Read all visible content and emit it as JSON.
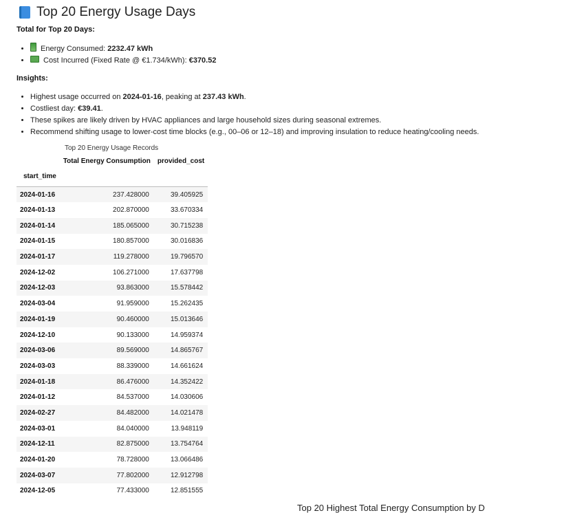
{
  "page": {
    "title": "Top 20 Energy Usage Days",
    "totals_heading": "Total for Top 20 Days:",
    "totals": [
      {
        "icon": "battery-icon",
        "label": "Energy Consumed: ",
        "value": "2232.47 kWh"
      },
      {
        "icon": "money-icon",
        "label": "Cost Incurred (Fixed Rate @ €1.734/kWh): ",
        "value": "€370.52"
      }
    ],
    "insights_heading": "Insights:",
    "insights": {
      "i1_pre": "Highest usage occurred on ",
      "i1_date": "2024-01-16",
      "i1_mid": ", peaking at ",
      "i1_value": "237.43 kWh",
      "i1_post": ".",
      "i2_pre": "Costliest day: ",
      "i2_value": "€39.41",
      "i2_post": ".",
      "i3": "These spikes are likely driven by HVAC appliances and large household sizes during seasonal extremes.",
      "i4": "Recommend shifting usage to lower-cost time blocks (e.g., 00–06 or 12–18) and improving insulation to reduce heating/cooling needs."
    }
  },
  "table": {
    "caption": "Top 20 Energy Usage Records",
    "columns": [
      "Total Energy Consumption",
      "provided_cost"
    ],
    "index_name": "start_time",
    "rows": [
      [
        "2024-01-16",
        "237.428000",
        "39.405925"
      ],
      [
        "2024-01-13",
        "202.870000",
        "33.670334"
      ],
      [
        "2024-01-14",
        "185.065000",
        "30.715238"
      ],
      [
        "2024-01-15",
        "180.857000",
        "30.016836"
      ],
      [
        "2024-01-17",
        "119.278000",
        "19.796570"
      ],
      [
        "2024-12-02",
        "106.271000",
        "17.637798"
      ],
      [
        "2024-12-03",
        "93.863000",
        "15.578442"
      ],
      [
        "2024-03-04",
        "91.959000",
        "15.262435"
      ],
      [
        "2024-01-19",
        "90.460000",
        "15.013646"
      ],
      [
        "2024-12-10",
        "90.133000",
        "14.959374"
      ],
      [
        "2024-03-06",
        "89.569000",
        "14.865767"
      ],
      [
        "2024-03-03",
        "88.339000",
        "14.661624"
      ],
      [
        "2024-01-18",
        "86.476000",
        "14.352422"
      ],
      [
        "2024-01-12",
        "84.537000",
        "14.030606"
      ],
      [
        "2024-02-27",
        "84.482000",
        "14.021478"
      ],
      [
        "2024-03-01",
        "84.040000",
        "13.948119"
      ],
      [
        "2024-12-11",
        "82.875000",
        "13.754764"
      ],
      [
        "2024-01-20",
        "78.728000",
        "13.066486"
      ],
      [
        "2024-03-07",
        "77.802000",
        "12.912798"
      ],
      [
        "2024-12-05",
        "77.433000",
        "12.851555"
      ]
    ]
  },
  "chart_title_partial": "Top 20 Highest Total Energy Consumption by D"
}
